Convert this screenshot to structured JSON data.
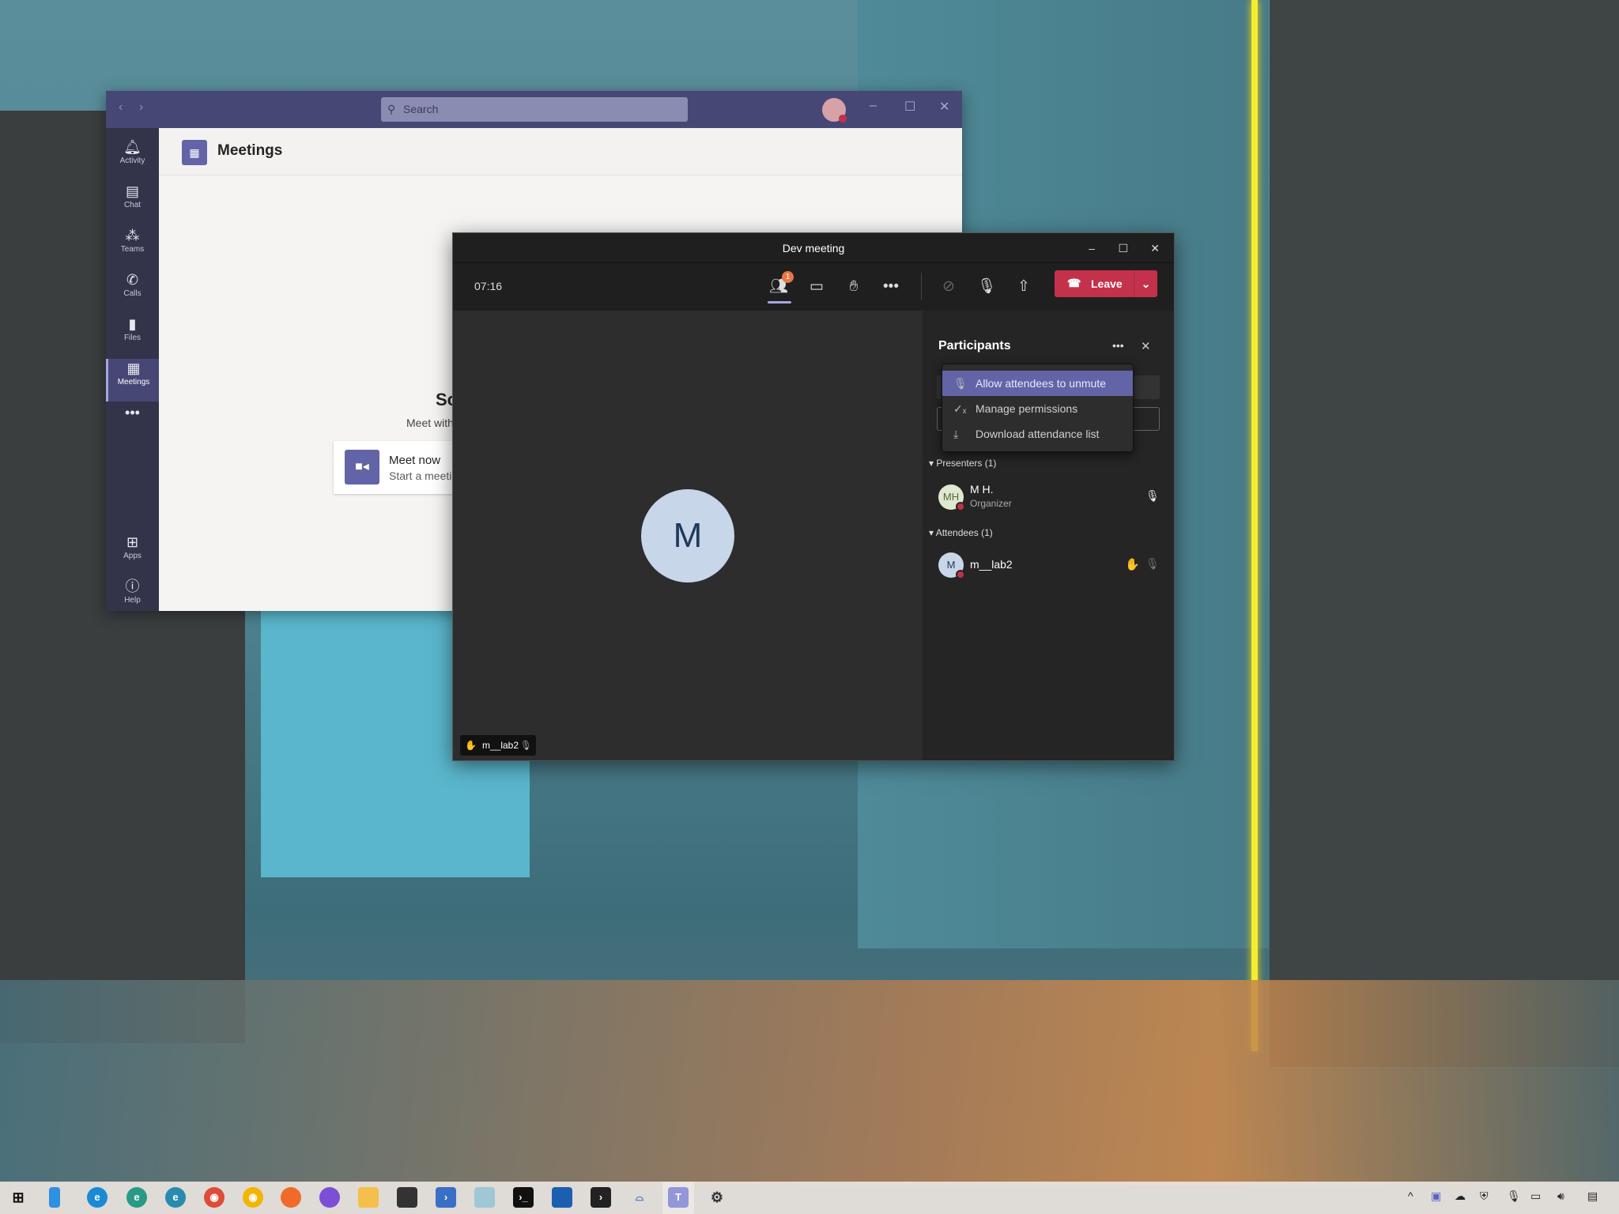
{
  "teams_window": {
    "search_placeholder": "Search",
    "page_title": "Meetings",
    "sidebar": [
      {
        "label": "Activity",
        "icon": "bell-icon"
      },
      {
        "label": "Chat",
        "icon": "chat-icon"
      },
      {
        "label": "Teams",
        "icon": "teams-icon"
      },
      {
        "label": "Calls",
        "icon": "phone-icon"
      },
      {
        "label": "Files",
        "icon": "file-icon"
      },
      {
        "label": "Meetings",
        "icon": "calendar-icon",
        "active": true
      },
      {
        "label": "",
        "icon": "more-icon"
      },
      {
        "label": "Apps",
        "icon": "apps-icon"
      },
      {
        "label": "Help",
        "icon": "help-icon"
      }
    ],
    "heading_partial": "Sc",
    "subheading_partial": "Meet with",
    "meet_now": {
      "title": "Meet now",
      "subtitle_partial": "Start a meeti"
    }
  },
  "meeting_window": {
    "title": "Dev meeting",
    "timer": "07:16",
    "participants_badge": "1",
    "leave_label": "Leave",
    "avatar_initial": "M",
    "tile_label": "m__lab2",
    "participants_panel": {
      "title": "Participants",
      "menu": [
        {
          "label": "Allow attendees to unmute",
          "icon": "mic-icon",
          "highlighted": true
        },
        {
          "label": "Manage permissions",
          "icon": "permissions-icon"
        },
        {
          "label": "Download attendance list",
          "icon": "download-icon"
        }
      ],
      "presenters_header": "Presenters (1)",
      "presenter": {
        "initials": "MH",
        "name": "M H.",
        "role": "Organizer"
      },
      "attendees_header": "Attendees (1)",
      "attendee": {
        "initials": "M",
        "name": "m__lab2"
      }
    }
  },
  "colors": {
    "teams_purple": "#464775",
    "accent": "#6264a7",
    "leave_red": "#c4314b"
  },
  "taskbar": {
    "icons": [
      "windows-start",
      "file-icon",
      "edge",
      "edge-dev",
      "edge-canary",
      "chrome",
      "chrome-canary",
      "firefox",
      "firefox-nightly",
      "file-explorer",
      "store",
      "powershell",
      "notepad",
      "terminal",
      "photos",
      "cmd",
      "network-drive",
      "teams",
      "settings"
    ]
  }
}
